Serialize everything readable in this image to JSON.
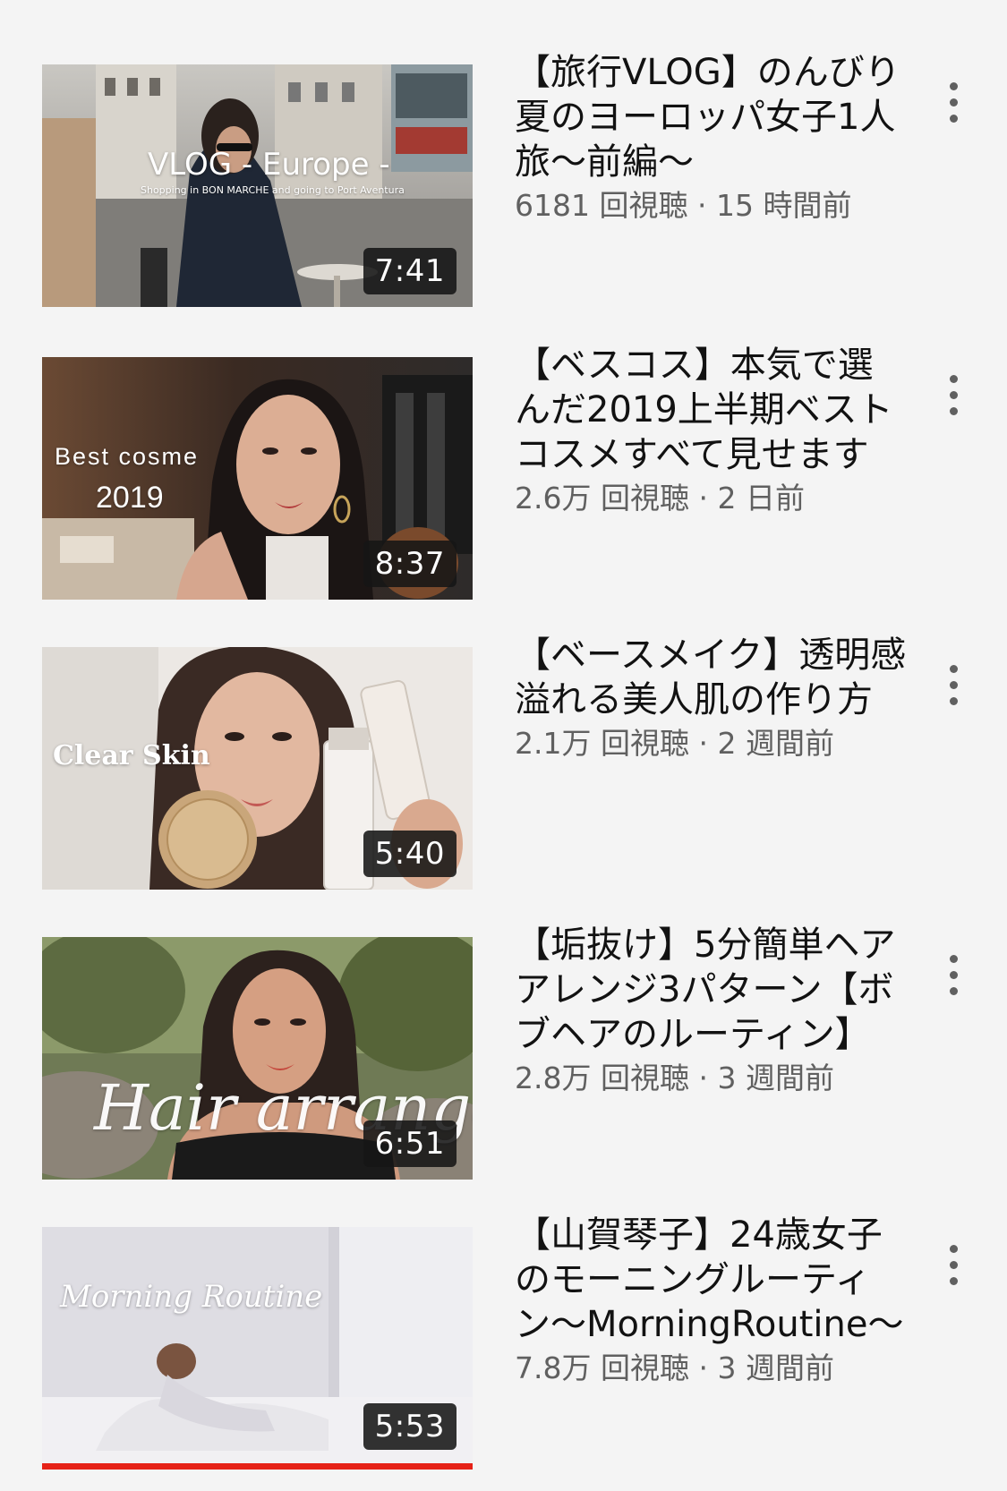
{
  "videos": [
    {
      "thumb_title": "VLOG - Europe -",
      "thumb_subtitle": "Shopping in BON MARCHE and going to Port Aventura",
      "duration": "7:41",
      "title": "【旅行VLOG】のんびり夏のヨーロッパ女子1人旅〜前編〜",
      "views": "6181 回視聴",
      "separator": "·",
      "age": "15 時間前",
      "progress": 0
    },
    {
      "thumb_title": "Best cosme",
      "thumb_subtitle": "2019",
      "duration": "8:37",
      "title": "【ベスコス】本気で選んだ2019上半期ベストコスメすべて見せます",
      "views": "2.6万 回視聴",
      "separator": "·",
      "age": "2 日前",
      "progress": 0
    },
    {
      "thumb_title": "Clear Skin",
      "duration": "5:40",
      "title": "【ベースメイク】透明感溢れる美人肌の作り方",
      "views": "2.1万 回視聴",
      "separator": "·",
      "age": "2 週間前",
      "progress": 0
    },
    {
      "thumb_title": "Hair arrange",
      "duration": "6:51",
      "title": "【垢抜け】5分簡単ヘアアレンジ3パターン【ボブヘアのルーティン】",
      "views": "2.8万 回視聴",
      "separator": "·",
      "age": "3 週間前",
      "progress": 0
    },
    {
      "thumb_title": "Morning Routine",
      "duration": "5:53",
      "title": "【山賀琴子】24歳女子のモーニングルーティン〜MorningRoutine〜",
      "views": "7.8万 回視聴",
      "separator": "·",
      "age": "3 週間前",
      "progress": 1.0
    }
  ],
  "icons": {
    "menu": "more-vert-icon"
  },
  "colors": {
    "background": "#f4f4f4",
    "title": "#121212",
    "meta": "#606060",
    "duration_bg": "#161616",
    "progress": "#e62117"
  }
}
